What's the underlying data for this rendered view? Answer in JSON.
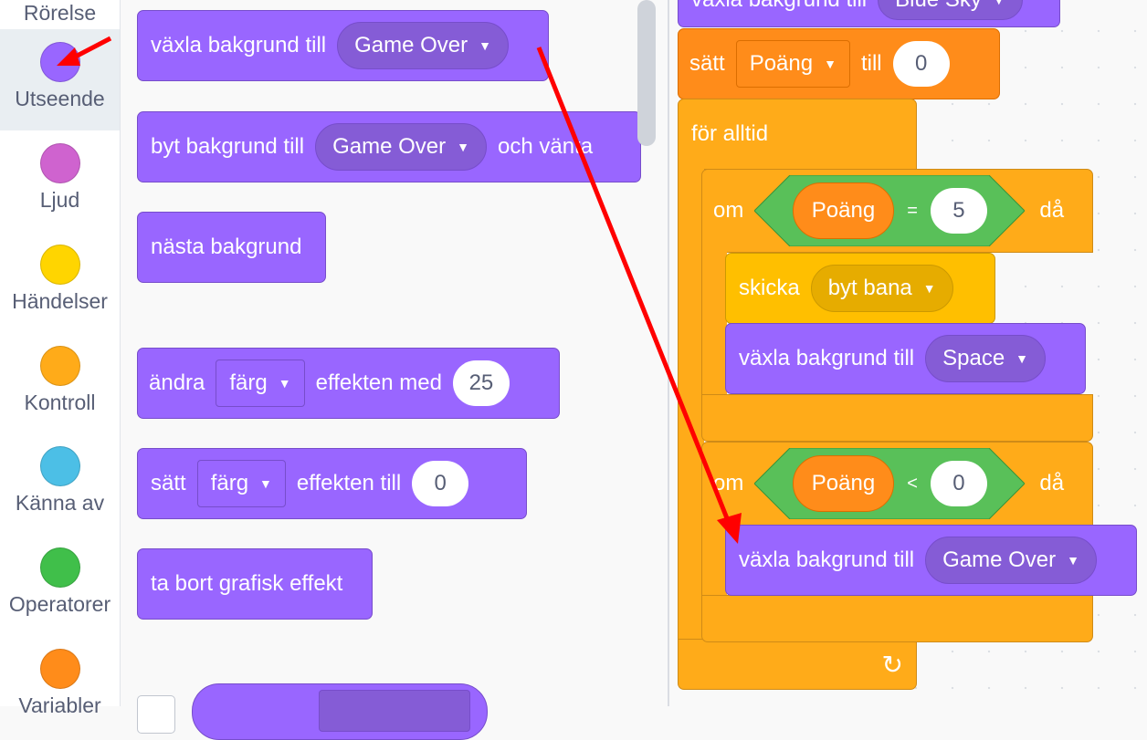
{
  "categories": [
    {
      "label": "Rörelse",
      "color": "#4c97ff"
    },
    {
      "label": "Utseende",
      "color": "#9966ff"
    },
    {
      "label": "Ljud",
      "color": "#cf63cf"
    },
    {
      "label": "Händelser",
      "color": "#ffd500"
    },
    {
      "label": "Kontroll",
      "color": "#ffab19"
    },
    {
      "label": "Känna av",
      "color": "#4cbfe6"
    },
    {
      "label": "Operatorer",
      "color": "#40bf4a"
    },
    {
      "label": "Variabler",
      "color": "#ff8c1a"
    }
  ],
  "palette": {
    "switch_backdrop": {
      "text": "växla bakgrund till",
      "value": "Game Over"
    },
    "switch_backdrop_wait": {
      "text": "byt bakgrund till",
      "value": "Game Over",
      "suffix": "och vänta"
    },
    "next_backdrop": {
      "text": "nästa bakgrund"
    },
    "change_effect": {
      "text": "ändra",
      "effect": "färg",
      "middle": "effekten med",
      "value": "25"
    },
    "set_effect": {
      "text": "sätt",
      "effect": "färg",
      "middle": "effekten till",
      "value": "0"
    },
    "clear_effects": {
      "text": "ta bort grafisk effekt"
    }
  },
  "script": {
    "top_block": {
      "text": "växla bakgrund till",
      "value": "Blue Sky"
    },
    "set_var": {
      "text": "sätt",
      "var": "Poäng",
      "middle": "till",
      "value": "0"
    },
    "forever": {
      "text": "för alltid"
    },
    "if1": {
      "text": "om",
      "then": "då",
      "var": "Poäng",
      "op": "=",
      "value": "5"
    },
    "broadcast": {
      "text": "skicka",
      "value": "byt bana"
    },
    "switch_space": {
      "text": "växla bakgrund till",
      "value": "Space"
    },
    "if2": {
      "text": "om",
      "then": "då",
      "var": "Poäng",
      "op": "<",
      "value": "0"
    },
    "switch_gameover": {
      "text": "växla bakgrund till",
      "value": "Game Over"
    },
    "loop_arrow": "↻"
  },
  "colors": {
    "looks": "#9966ff",
    "control": "#ffab19",
    "variables": "#ff8c1a",
    "events": "#ffbf00",
    "operators": "#59c059",
    "annotation": "#ff0000"
  }
}
